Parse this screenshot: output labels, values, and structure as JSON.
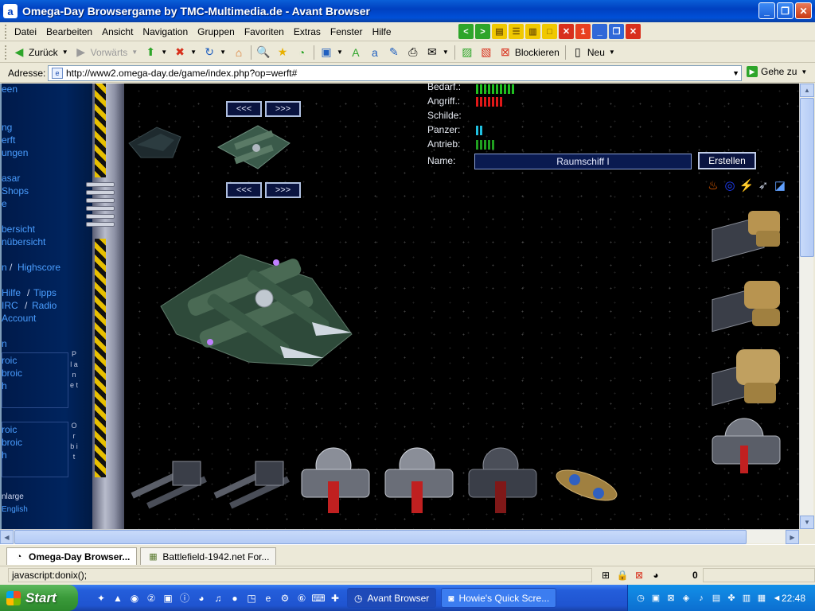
{
  "window": {
    "title": "Omega-Day Browsergame by TMC-Multimedia.de - Avant Browser",
    "minimize_label": "_",
    "maximize_label": "❐",
    "close_label": "✕"
  },
  "menu": {
    "items": [
      "Datei",
      "Bearbeiten",
      "Ansicht",
      "Navigation",
      "Gruppen",
      "Favoriten",
      "Extras",
      "Fenster",
      "Hilfe"
    ],
    "mdi_number": "1"
  },
  "toolbar": {
    "back_label": "Zurück",
    "forward_label": "Vorwärts",
    "block_label": "Blockieren",
    "new_label": "Neu"
  },
  "address": {
    "label": "Adresse:",
    "url": "http://www2.omega-day.de/game/index.php?op=werft#",
    "go_label": "Gehe zu"
  },
  "game": {
    "nav_links": [
      {
        "text": "een",
        "color": "blue"
      },
      {
        "text": "ng",
        "color": "blue"
      },
      {
        "text": "erft",
        "color": "blue"
      },
      {
        "text": "ungen",
        "color": "blue"
      },
      {
        "text": "asar",
        "color": "blue"
      },
      {
        "text": " Shops",
        "color": "blue"
      },
      {
        "text": "e",
        "color": "blue"
      },
      {
        "text": "bersicht",
        "color": "blue"
      },
      {
        "text": "nübersicht",
        "color": "blue"
      },
      {
        "text": "n",
        "color": "blue"
      },
      {
        "text": "Highscore",
        "color": "blue"
      },
      {
        "text": "Hilfe",
        "color": "blue"
      },
      {
        "text": "Tipps",
        "color": "blue"
      },
      {
        "text": " IRC",
        "color": "blue"
      },
      {
        "text": "Radio",
        "color": "blue"
      },
      {
        "text": " Account",
        "color": "blue"
      },
      {
        "text": "n",
        "color": "blue"
      },
      {
        "text": "roic",
        "color": "blue"
      },
      {
        "text": "broic",
        "color": "blue"
      },
      {
        "text": "h",
        "color": "blue"
      },
      {
        "text": "roic",
        "color": "blue"
      },
      {
        "text": "broic",
        "color": "blue"
      },
      {
        "text": "h",
        "color": "blue"
      },
      {
        "text": "nlarge",
        "color": "white"
      },
      {
        "text": " English",
        "color": "blue"
      }
    ],
    "planet_label": "P l a n e t",
    "orbit_label": "O r b i t",
    "separator": "/",
    "prev_label": "<<<",
    "next_label": ">>>",
    "stats": [
      {
        "label": "Bedarf.:",
        "bars": 10,
        "color": "#20c020"
      },
      {
        "label": "Angriff.:",
        "bars": 7,
        "color": "#e01818"
      },
      {
        "label": "Schilde:",
        "bars": 0,
        "color": "#2080e0"
      },
      {
        "label": "Panzer:",
        "bars": 2,
        "color": "#20c0e0"
      },
      {
        "label": "Antrieb:",
        "bars": 5,
        "color": "#20a020"
      }
    ],
    "name_label": "Name:",
    "name_value": "Raumschiff I",
    "create_label": "Erstellen",
    "effect_icons": [
      "flame-icon",
      "ring-icon",
      "lightning-icon",
      "missile-icon",
      "shield-icon"
    ]
  },
  "tabs": [
    {
      "label": "Omega-Day Browser...",
      "active": true
    },
    {
      "label": "Battlefield-1942.net For...",
      "active": false
    }
  ],
  "status": {
    "text": "javascript:donix();",
    "count": "0"
  },
  "taskbar": {
    "start_label": "Start",
    "tasks": [
      {
        "label": "Avant Browser",
        "active": true
      },
      {
        "label": "Howie's Quick Scre...",
        "active": false
      }
    ],
    "clock": "22:48"
  }
}
